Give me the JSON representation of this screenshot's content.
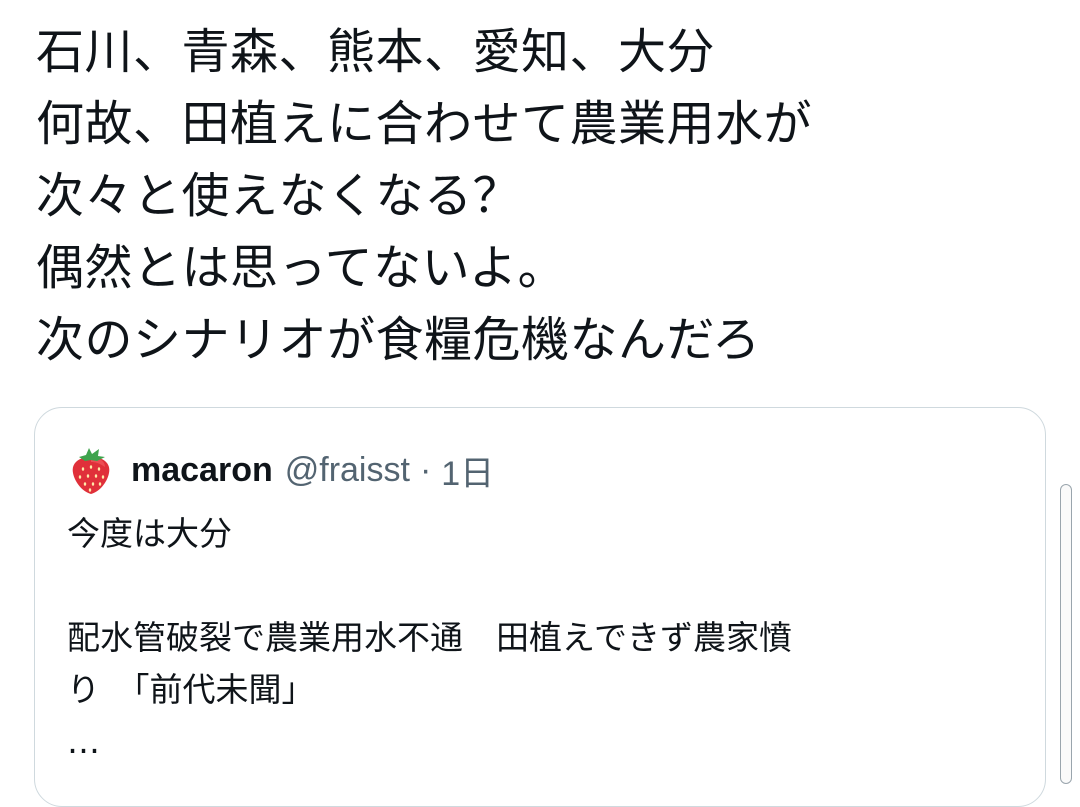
{
  "tweet": {
    "lines": [
      "石川、青森、熊本、愛知、大分",
      "何故、田植えに合わせて農業用水が",
      "次々と使えなくなる？",
      "偶然とは思ってないよ。",
      "次のシナリオが食糧危機なんだろ"
    ]
  },
  "quoted_tweet": {
    "avatar_icon": "strawberry-icon",
    "author_name": "macaron",
    "author_handle": "@fraisst",
    "separator": "·",
    "time": "1日",
    "body_lines": [
      "今度は大分",
      "",
      "配水管破裂で農業用水不通　田植えできず農家憤",
      "り　「前代未聞」",
      "…"
    ]
  },
  "colors": {
    "text_primary": "#0f1419",
    "text_secondary": "#536471",
    "border": "#cfd9de",
    "strawberry_red": "#e0303a",
    "strawberry_leaf": "#3fa34d"
  }
}
